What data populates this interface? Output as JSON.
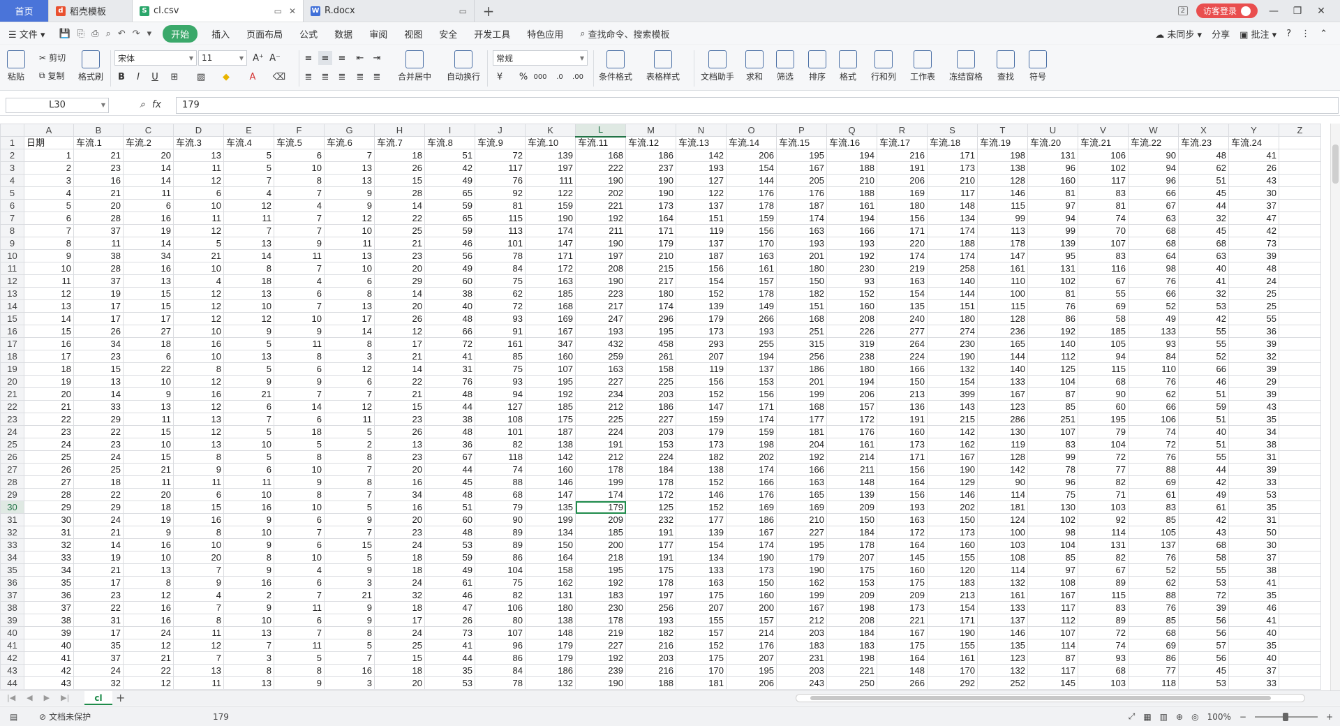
{
  "titlebar": {
    "tabs": [
      {
        "label": "首页"
      },
      {
        "label": "稻壳模板"
      },
      {
        "label": "cl.csv"
      },
      {
        "label": "R.docx"
      }
    ],
    "badge": "2",
    "login": "访客登录"
  },
  "menubar": {
    "file": "文件",
    "items": [
      "开始",
      "插入",
      "页面布局",
      "公式",
      "数据",
      "审阅",
      "视图",
      "安全",
      "开发工具",
      "特色应用"
    ],
    "search": "查找命令、搜索模板",
    "right": [
      "未同步",
      "分享",
      "批注"
    ]
  },
  "ribbon": {
    "paste": "粘贴",
    "cut": "剪切",
    "copy": "复制",
    "format_painter": "格式刷",
    "font": "宋体",
    "size": "11",
    "numfmt": "常规",
    "merge": "合并居中",
    "wrap": "自动换行",
    "cond": "条件格式",
    "tablestyle": "表格样式",
    "doc": "文档助手",
    "sum": "求和",
    "filter": "筛选",
    "sort": "排序",
    "format": "格式",
    "rowcol": "行和列",
    "sheet": "工作表",
    "freeze": "冻结窗格",
    "find": "查找",
    "symbol": "符号"
  },
  "formula": {
    "cell": "L30",
    "value": "179"
  },
  "grid": {
    "columns": [
      "A",
      "B",
      "C",
      "D",
      "E",
      "F",
      "G",
      "H",
      "I",
      "J",
      "K",
      "L",
      "M",
      "N",
      "O",
      "P",
      "Q",
      "R",
      "S",
      "T",
      "U",
      "V",
      "W",
      "X",
      "Y",
      "Z"
    ],
    "header": [
      "日期",
      "车流.1",
      "车流.2",
      "车流.3",
      "车流.4",
      "车流.5",
      "车流.6",
      "车流.7",
      "车流.8",
      "车流.9",
      "车流.10",
      "车流.11",
      "车流.12",
      "车流.13",
      "车流.14",
      "车流.15",
      "车流.16",
      "车流.17",
      "车流.18",
      "车流.19",
      "车流.20",
      "车流.21",
      "车流.22",
      "车流.23",
      "车流.24",
      ""
    ],
    "rows": [
      [
        1,
        21,
        20,
        13,
        5,
        6,
        7,
        18,
        51,
        72,
        139,
        168,
        186,
        142,
        206,
        195,
        194,
        216,
        171,
        198,
        131,
        106,
        90,
        48,
        41
      ],
      [
        2,
        23,
        14,
        11,
        5,
        10,
        13,
        26,
        42,
        117,
        197,
        222,
        237,
        193,
        154,
        167,
        188,
        191,
        173,
        138,
        96,
        102,
        94,
        62,
        26
      ],
      [
        3,
        16,
        14,
        12,
        7,
        8,
        13,
        15,
        49,
        76,
        111,
        190,
        190,
        127,
        144,
        205,
        210,
        206,
        210,
        128,
        160,
        117,
        96,
        51,
        43
      ],
      [
        4,
        21,
        11,
        6,
        4,
        7,
        9,
        28,
        65,
        92,
        122,
        202,
        190,
        122,
        176,
        176,
        188,
        169,
        117,
        146,
        81,
        83,
        66,
        45,
        30
      ],
      [
        5,
        20,
        6,
        10,
        12,
        4,
        9,
        14,
        59,
        81,
        159,
        221,
        173,
        137,
        178,
        187,
        161,
        180,
        148,
        115,
        97,
        81,
        67,
        44,
        37
      ],
      [
        6,
        28,
        16,
        11,
        11,
        7,
        12,
        22,
        65,
        115,
        190,
        192,
        164,
        151,
        159,
        174,
        194,
        156,
        134,
        99,
        94,
        74,
        63,
        32,
        47
      ],
      [
        7,
        37,
        19,
        12,
        7,
        7,
        10,
        25,
        59,
        113,
        174,
        211,
        171,
        119,
        156,
        163,
        166,
        171,
        174,
        113,
        99,
        70,
        68,
        45,
        42
      ],
      [
        8,
        11,
        14,
        5,
        13,
        9,
        11,
        21,
        46,
        101,
        147,
        190,
        179,
        137,
        170,
        193,
        193,
        220,
        188,
        178,
        139,
        107,
        68,
        68,
        73
      ],
      [
        9,
        38,
        34,
        21,
        14,
        11,
        13,
        23,
        56,
        78,
        171,
        197,
        210,
        187,
        163,
        201,
        192,
        174,
        174,
        147,
        95,
        83,
        64,
        63,
        39
      ],
      [
        10,
        28,
        16,
        10,
        8,
        7,
        10,
        20,
        49,
        84,
        172,
        208,
        215,
        156,
        161,
        180,
        230,
        219,
        258,
        161,
        131,
        116,
        98,
        40,
        48
      ],
      [
        11,
        37,
        13,
        4,
        18,
        4,
        6,
        29,
        60,
        75,
        163,
        190,
        217,
        154,
        157,
        150,
        93,
        163,
        140,
        110,
        102,
        67,
        76,
        41,
        24
      ],
      [
        12,
        19,
        15,
        12,
        13,
        6,
        8,
        14,
        38,
        62,
        185,
        223,
        180,
        152,
        178,
        182,
        152,
        154,
        144,
        100,
        81,
        55,
        66,
        32,
        25
      ],
      [
        13,
        17,
        15,
        12,
        10,
        7,
        13,
        20,
        40,
        72,
        168,
        217,
        174,
        139,
        149,
        151,
        160,
        135,
        151,
        115,
        76,
        69,
        52,
        53,
        25
      ],
      [
        14,
        17,
        17,
        12,
        12,
        10,
        17,
        26,
        48,
        93,
        169,
        247,
        296,
        179,
        266,
        168,
        208,
        240,
        180,
        128,
        86,
        58,
        49,
        42,
        55
      ],
      [
        15,
        26,
        27,
        10,
        9,
        9,
        14,
        12,
        66,
        91,
        167,
        193,
        195,
        173,
        193,
        251,
        226,
        277,
        274,
        236,
        192,
        185,
        133,
        55,
        36
      ],
      [
        16,
        34,
        18,
        16,
        5,
        11,
        8,
        17,
        72,
        161,
        347,
        432,
        458,
        293,
        255,
        315,
        319,
        264,
        230,
        165,
        140,
        105,
        93,
        55,
        39
      ],
      [
        17,
        23,
        6,
        10,
        13,
        8,
        3,
        21,
        41,
        85,
        160,
        259,
        261,
        207,
        194,
        256,
        238,
        224,
        190,
        144,
        112,
        94,
        84,
        52,
        32
      ],
      [
        18,
        15,
        22,
        8,
        5,
        6,
        12,
        14,
        31,
        75,
        107,
        163,
        158,
        119,
        137,
        186,
        180,
        166,
        132,
        140,
        125,
        115,
        110,
        66,
        39
      ],
      [
        19,
        13,
        10,
        12,
        9,
        9,
        6,
        22,
        76,
        93,
        195,
        227,
        225,
        156,
        153,
        201,
        194,
        150,
        154,
        133,
        104,
        68,
        76,
        46,
        29
      ],
      [
        20,
        14,
        9,
        16,
        21,
        7,
        7,
        21,
        48,
        94,
        192,
        234,
        203,
        152,
        156,
        199,
        206,
        213,
        399,
        167,
        87,
        90,
        62,
        51,
        39
      ],
      [
        21,
        33,
        13,
        12,
        6,
        14,
        12,
        15,
        44,
        127,
        185,
        212,
        186,
        147,
        171,
        168,
        157,
        136,
        143,
        123,
        85,
        60,
        66,
        59,
        43
      ],
      [
        22,
        29,
        11,
        13,
        7,
        6,
        11,
        23,
        38,
        108,
        175,
        225,
        227,
        159,
        174,
        177,
        172,
        191,
        215,
        286,
        251,
        195,
        106,
        51,
        35
      ],
      [
        23,
        22,
        15,
        12,
        5,
        18,
        5,
        26,
        48,
        101,
        187,
        224,
        203,
        179,
        159,
        181,
        176,
        160,
        142,
        130,
        107,
        79,
        74,
        40,
        34
      ],
      [
        24,
        23,
        10,
        13,
        10,
        5,
        2,
        13,
        36,
        82,
        138,
        191,
        153,
        173,
        198,
        204,
        161,
        173,
        162,
        119,
        83,
        104,
        72,
        51,
        38
      ],
      [
        25,
        24,
        15,
        8,
        5,
        8,
        8,
        23,
        67,
        118,
        142,
        212,
        224,
        182,
        202,
        192,
        214,
        171,
        167,
        128,
        99,
        72,
        76,
        55,
        31
      ],
      [
        26,
        25,
        21,
        9,
        6,
        10,
        7,
        20,
        44,
        74,
        160,
        178,
        184,
        138,
        174,
        166,
        211,
        156,
        190,
        142,
        78,
        77,
        88,
        44,
        39
      ],
      [
        27,
        18,
        11,
        11,
        11,
        9,
        8,
        16,
        45,
        88,
        146,
        199,
        178,
        152,
        166,
        163,
        148,
        164,
        129,
        90,
        96,
        82,
        69,
        42,
        33
      ],
      [
        28,
        22,
        20,
        6,
        10,
        8,
        7,
        34,
        48,
        68,
        147,
        174,
        172,
        146,
        176,
        165,
        139,
        156,
        146,
        114,
        75,
        71,
        61,
        49,
        53
      ],
      [
        29,
        29,
        18,
        15,
        16,
        10,
        5,
        16,
        51,
        79,
        135,
        179,
        125,
        152,
        169,
        169,
        209,
        193,
        202,
        181,
        130,
        103,
        83,
        61,
        35
      ],
      [
        30,
        24,
        19,
        16,
        9,
        6,
        9,
        20,
        60,
        90,
        199,
        209,
        232,
        177,
        186,
        210,
        150,
        163,
        150,
        124,
        102,
        92,
        85,
        42,
        31
      ],
      [
        31,
        21,
        9,
        8,
        10,
        7,
        7,
        23,
        48,
        89,
        134,
        185,
        191,
        139,
        167,
        227,
        184,
        172,
        173,
        100,
        98,
        114,
        105,
        43,
        50
      ],
      [
        32,
        14,
        16,
        10,
        9,
        6,
        15,
        24,
        53,
        89,
        150,
        200,
        177,
        154,
        174,
        195,
        178,
        164,
        160,
        103,
        104,
        131,
        137,
        68,
        30
      ],
      [
        33,
        19,
        10,
        20,
        8,
        10,
        5,
        18,
        59,
        86,
        164,
        218,
        191,
        134,
        190,
        179,
        207,
        145,
        155,
        108,
        85,
        82,
        76,
        58,
        37
      ],
      [
        34,
        21,
        13,
        7,
        9,
        4,
        9,
        18,
        49,
        104,
        158,
        195,
        175,
        133,
        173,
        190,
        175,
        160,
        120,
        114,
        97,
        67,
        52,
        55,
        38
      ],
      [
        35,
        17,
        8,
        9,
        16,
        6,
        3,
        24,
        61,
        75,
        162,
        192,
        178,
        163,
        150,
        162,
        153,
        175,
        183,
        132,
        108,
        89,
        62,
        53,
        41
      ],
      [
        36,
        23,
        12,
        4,
        2,
        7,
        21,
        32,
        46,
        82,
        131,
        183,
        197,
        175,
        160,
        199,
        209,
        209,
        213,
        161,
        167,
        115,
        88,
        72,
        35
      ],
      [
        37,
        22,
        16,
        7,
        9,
        11,
        9,
        18,
        47,
        106,
        180,
        230,
        256,
        207,
        200,
        167,
        198,
        173,
        154,
        133,
        117,
        83,
        76,
        39,
        46
      ],
      [
        38,
        31,
        16,
        8,
        10,
        6,
        9,
        17,
        26,
        80,
        138,
        178,
        193,
        155,
        157,
        212,
        208,
        221,
        171,
        137,
        112,
        89,
        85,
        56,
        41
      ],
      [
        39,
        17,
        24,
        11,
        13,
        7,
        8,
        24,
        73,
        107,
        148,
        219,
        182,
        157,
        214,
        203,
        184,
        167,
        190,
        146,
        107,
        72,
        68,
        56,
        40
      ],
      [
        40,
        35,
        12,
        12,
        7,
        11,
        5,
        25,
        41,
        96,
        179,
        227,
        216,
        152,
        176,
        183,
        183,
        175,
        155,
        135,
        114,
        74,
        69,
        57,
        35
      ],
      [
        41,
        37,
        21,
        7,
        3,
        5,
        7,
        15,
        44,
        86,
        179,
        192,
        203,
        175,
        207,
        231,
        198,
        164,
        161,
        123,
        87,
        93,
        86,
        56,
        40
      ],
      [
        42,
        24,
        22,
        13,
        8,
        8,
        16,
        18,
        35,
        84,
        186,
        239,
        216,
        170,
        195,
        203,
        221,
        148,
        170,
        132,
        117,
        68,
        77,
        45,
        37
      ],
      [
        43,
        32,
        12,
        11,
        13,
        9,
        3,
        20,
        53,
        78,
        132,
        190,
        188,
        181,
        206,
        243,
        250,
        266,
        292,
        252,
        145,
        103,
        118,
        53,
        33
      ]
    ]
  },
  "sheet": {
    "name": "cl"
  },
  "status": {
    "protect": "文档未保护",
    "value": "179",
    "zoom": "100%"
  }
}
